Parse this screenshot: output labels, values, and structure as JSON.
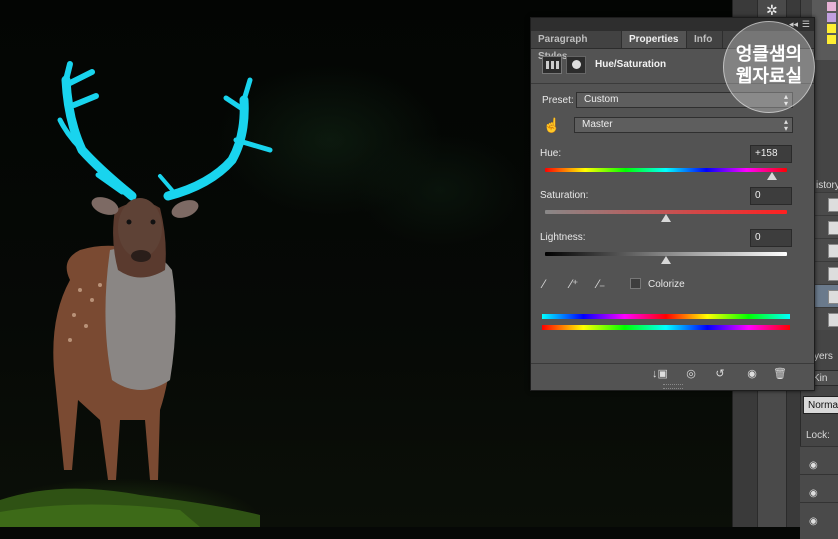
{
  "panel": {
    "tabs": [
      {
        "label": "Paragraph Styles"
      },
      {
        "label": "Properties"
      },
      {
        "label": "Info"
      }
    ],
    "collapse_glyph": "◂◂",
    "menu_glyph": "☰",
    "adjustment_title": "Hue/Saturation",
    "preset": {
      "label": "Preset:",
      "value": "Custom"
    },
    "channel": {
      "value": "Master"
    },
    "hue": {
      "label": "Hue:",
      "value": "+158",
      "slider_fraction": 0.94
    },
    "saturation": {
      "label": "Saturation:",
      "value": "0",
      "slider_fraction": 0.5
    },
    "lightness": {
      "label": "Lightness:",
      "value": "0",
      "slider_fraction": 0.5
    },
    "colorize": {
      "label": "Colorize",
      "checked": false
    },
    "icons": {
      "adj_layer": "adjustment-layer-icon",
      "mask": "mask-icon",
      "target_adjust": "hand-target-icon",
      "eyedroppers": [
        "eyedropper-icon",
        "eyedropper-plus-icon",
        "eyedropper-minus-icon"
      ],
      "footer": [
        "clip-to-layer-icon",
        "view-previous-icon",
        "reset-icon",
        "visibility-icon",
        "trash-icon"
      ]
    }
  },
  "side": {
    "history_label": "istory",
    "layers_label": "yers",
    "kind_label": "Kin",
    "blend_mode": "Norma",
    "lock_label": "Lock:"
  },
  "watermark": {
    "line1": "엉클샘의",
    "line2": "웹자료실"
  },
  "accent_colors": {
    "panel_bg": "#535353",
    "tab_bg": "#424242",
    "antlers": "#19d4ee"
  }
}
